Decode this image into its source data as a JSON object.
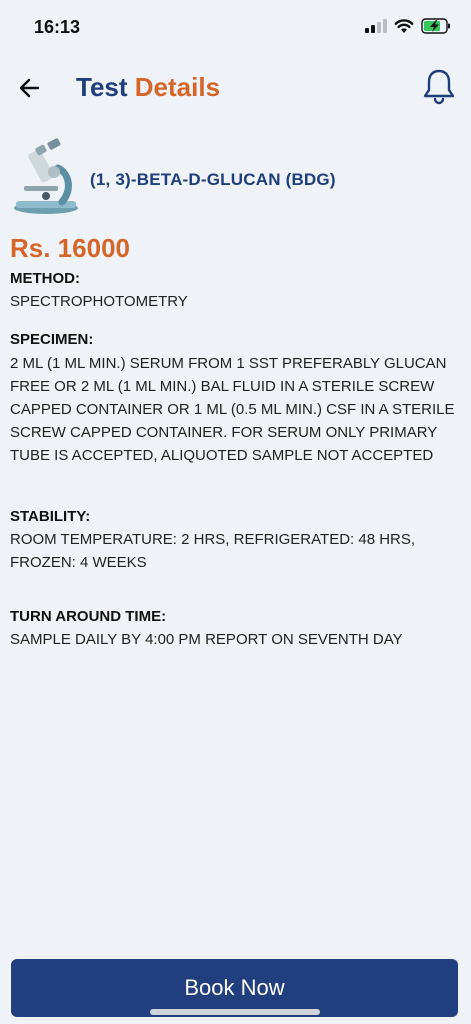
{
  "status": {
    "time": "16:13"
  },
  "header": {
    "title_part1": "Test",
    "title_part2": "Details"
  },
  "test": {
    "name": "(1, 3)-BETA-D-GLUCAN (BDG)",
    "price": "Rs. 16000",
    "method_label": "METHOD:",
    "method": "SPECTROPHOTOMETRY",
    "specimen_label": "SPECIMEN:",
    "specimen": "2 ML (1 ML MIN.) SERUM FROM 1 SST PREFERABLY GLUCAN FREE OR 2 ML (1 ML MIN.) BAL FLUID IN A STERILE SCREW CAPPED CONTAINER OR 1 ML (0.5 ML MIN.) CSF IN A STERILE SCREW CAPPED CONTAINER. FOR SERUM ONLY PRIMARY TUBE IS ACCEPTED, ALIQUOTED SAMPLE NOT ACCEPTED",
    "stability_label": "STABILITY:",
    "stability": "ROOM TEMPERATURE: 2 HRS, REFRIGERATED: 48 HRS, FROZEN: 4 WEEKS",
    "tat_label": "TURN AROUND TIME:",
    "tat": "SAMPLE DAILY BY 4:00 PM REPORT ON SEVENTH DAY"
  },
  "actions": {
    "book_label": "Book Now"
  },
  "colors": {
    "primary": "#1f3e7c",
    "accent": "#d4662a",
    "button": "#213f7e",
    "background": "#eff2f6"
  },
  "icons": {
    "back": "arrow-left-icon",
    "notification": "bell-icon",
    "test": "microscope-icon",
    "signal": "signal-icon",
    "wifi": "wifi-icon",
    "battery": "battery-charging-icon"
  }
}
